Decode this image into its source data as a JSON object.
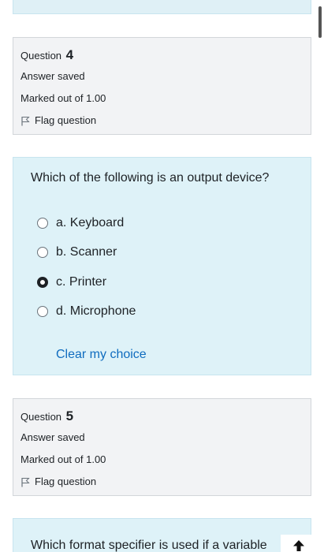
{
  "question4": {
    "label": "Question",
    "number": "4",
    "state": "Answer saved",
    "grade": "Marked out of 1.00",
    "flag_label": "Flag question",
    "text": "Which of the following is an output device?",
    "options": [
      {
        "label": "a. Keyboard",
        "selected": false
      },
      {
        "label": "b. Scanner",
        "selected": false
      },
      {
        "label": "c. Printer",
        "selected": true
      },
      {
        "label": "d. Microphone",
        "selected": false
      }
    ],
    "clear_label": "Clear my choice"
  },
  "question5": {
    "label": "Question",
    "number": "5",
    "state": "Answer saved",
    "grade": "Marked out of 1.00",
    "flag_label": "Flag question",
    "text": "Which format specifier is used if a variable"
  },
  "icons": {
    "flag": "flag-icon",
    "back_to_top": "arrow-up-icon",
    "radio_selected": "radio-checked-icon",
    "radio_unselected": "radio-unchecked-icon"
  },
  "colors": {
    "info_bg": "#f2f3f5",
    "content_bg": "#def2f8",
    "link": "#0f6cbf"
  }
}
